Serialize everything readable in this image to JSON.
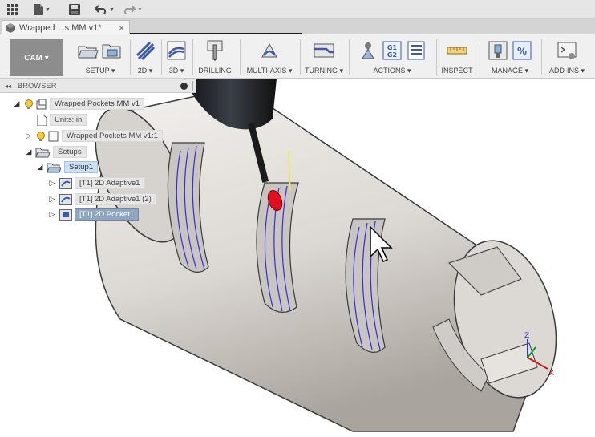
{
  "document": {
    "tab_title": "Wrapped ...s MM v1*",
    "close": "×"
  },
  "workspace": {
    "label": "CAM ▾"
  },
  "toolbar": {
    "groups": [
      {
        "label": "SETUP ▾"
      },
      {
        "label": "2D ▾"
      },
      {
        "label": "3D ▾"
      },
      {
        "label": "DRILLING"
      },
      {
        "label": "MULTI-AXIS ▾"
      },
      {
        "label": "TURNING ▾"
      },
      {
        "label": "ACTIONS ▾"
      },
      {
        "label": "INSPECT"
      },
      {
        "label": "MANAGE ▾"
      },
      {
        "label": "ADD-INS ▾"
      }
    ],
    "g1g2_top": "G1",
    "g1g2_bottom": "G2",
    "manage_symbol": "%"
  },
  "browser": {
    "title": "BROWSER",
    "collapse": "◂◂",
    "root": "Wrapped Pockets MM v1",
    "units": "Units: in",
    "component": "Wrapped Pockets MM v1:1",
    "setups": "Setups",
    "setup1": "Setup1",
    "ops": [
      {
        "label": "[T1] 2D Adaptive1"
      },
      {
        "label": "[T1] 2D Adaptive1 (2)"
      },
      {
        "label": "[T1] 2D Pocket1"
      }
    ]
  },
  "triad": {
    "z": "Z",
    "x": "X"
  },
  "colors": {
    "workspace": "#8d8d8d",
    "selection": "#cde0f3",
    "active_op": "#8ea6c1",
    "toolpath": "#3a2ad8",
    "tool": "#e01020"
  }
}
